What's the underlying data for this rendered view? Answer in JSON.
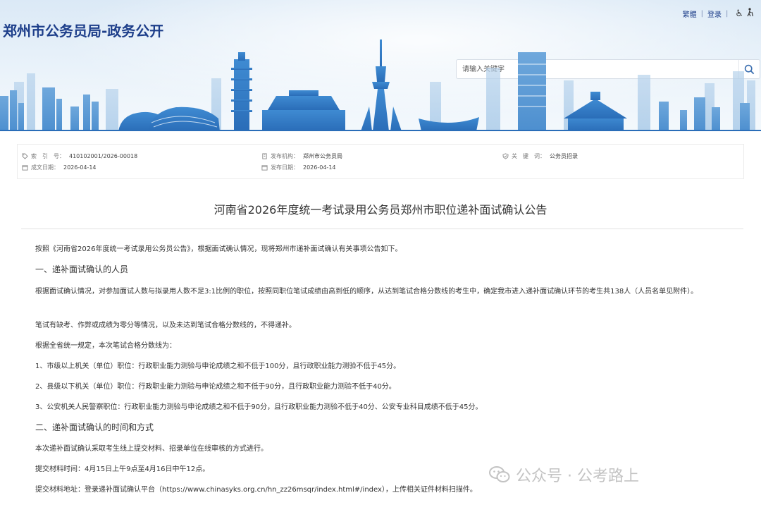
{
  "header": {
    "site_title": "郑州市公务员局-政务公开",
    "links": [
      "繁體",
      "登录"
    ],
    "accessibility_icon": "wheelchair-icon",
    "senior_icon": "elder-icon",
    "search": {
      "placeholder": "请输入关键字",
      "icon": "search-icon"
    }
  },
  "meta": {
    "index_label": "索　引　号：",
    "index_value": "410102001/2026-00018",
    "publisher_label": "发布机构：",
    "publisher_value": "郑州市公务员局",
    "keyword_label": "关　键　词：",
    "keyword_value": "公务员招录",
    "created_label": "成文日期：",
    "created_value": "2026-04-14",
    "published_label": "发布日期：",
    "published_value": "2026-04-14"
  },
  "article": {
    "title": "河南省2026年度统一考试录用公务员郑州市职位递补面试确认公告",
    "intro": "按照《河南省2026年度统一考试录用公务员公告》，根据面试确认情况，现将郑州市递补面试确认有关事项公告如下。",
    "section1_title": "一、递补面试确认的人员",
    "p1": "根据面试确认情况，对参加面试人数与拟录用人数不足3:1比例的职位，按照同职位笔试成绩由高到低的顺序，从达到笔试合格分数线的考生中，确定我市进入递补面试确认环节的考生共138人（人员名单见附件）。",
    "p2": "笔试有缺考、作弊或成绩为零分等情况，以及未达到笔试合格分数线的，不得递补。",
    "p3": "根据全省统一规定，本次笔试合格分数线为：",
    "p4": "1、市级以上机关（单位）职位：行政职业能力测验与申论成绩之和不低于100分，且行政职业能力测验不低于45分。",
    "p5": "2、县级以下机关（单位）职位：行政职业能力测验与申论成绩之和不低于90分，且行政职业能力测验不低于40分。",
    "p6": "3、公安机关人民警察职位：行政职业能力测验与申论成绩之和不低于90分，且行政职业能力测验不低于40分、公安专业科目成绩不低于45分。",
    "section2_title": "二、递补面试确认的时间和方式",
    "p7": "本次递补面试确认采取考生线上提交材料、招录单位在线审核的方式进行。",
    "p8": "提交材料时间：4月15日上午9点至4月16日中午12点。",
    "p9": "提交材料地址：登录递补面试确认平台（https://www.chinasyks.org.cn/hn_zz26msqr/index.html#/index），上传相关证件材料扫描件。"
  },
  "watermark": {
    "text": "公众号 · 公考路上",
    "icon": "wechat-icon"
  },
  "colors": {
    "title_blue": "#1d3e8a",
    "skyline_blue": "#2f7fc8"
  }
}
